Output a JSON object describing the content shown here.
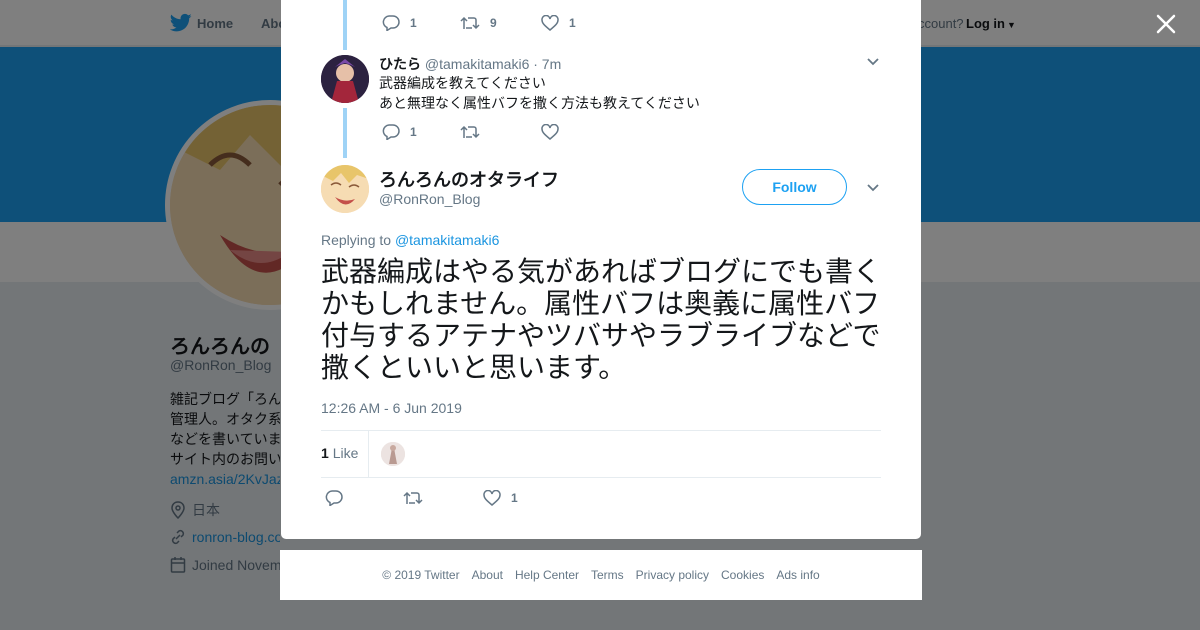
{
  "colors": {
    "accent": "#1da1f2",
    "thread_line": "#9fd3f6",
    "text_secondary": "#657786",
    "overlay": "rgba(0,0,0,0.5)"
  },
  "background": {
    "nav": {
      "home": "Home",
      "about": "Abo",
      "account_prompt": "ccount?",
      "login": "Log in"
    },
    "profile": {
      "name": "ろんろんの",
      "handle": "@RonRon_Blog",
      "bio_lines": [
        "雑記ブログ「ろん",
        "管理人。オタク系",
        "などを書いていま",
        "サイト内のお問い"
      ],
      "bio_link": "amzn.asia/2KvJaz",
      "location": "日本",
      "website": "ronron-blog.com",
      "joined": "Joined Novem"
    }
  },
  "thread": {
    "top_actions": {
      "replies": "1",
      "retweets": "9",
      "likes": "1"
    },
    "reply": {
      "name": "ひたら",
      "handle": "@tamakitamaki6",
      "time": "· 7m",
      "lines": [
        "武器編成を教えてください",
        "あと無理なく属性バフを撒く方法も教えてください"
      ],
      "actions": {
        "replies": "1",
        "retweets": "",
        "likes": ""
      }
    },
    "main": {
      "name": "ろんろんのオタライフ",
      "handle": "@RonRon_Blog",
      "follow_label": "Follow",
      "replying_prefix": "Replying to",
      "replying_to": "@tamakitamaki6",
      "text": "武器編成はやる気があればブログにでも書くかもしれません。属性バフは奥義に属性バフ付与するアテナやツバサやラブライブなどで撒くといいと思います。",
      "timestamp": "12:26 AM - 6 Jun 2019",
      "like_count": "1",
      "like_label": "Like",
      "actions": {
        "replies": "",
        "retweets": "",
        "likes": "1"
      }
    }
  },
  "footer": {
    "copyright": "© 2019 Twitter",
    "links": [
      "About",
      "Help Center",
      "Terms",
      "Privacy policy",
      "Cookies",
      "Ads info"
    ]
  },
  "icons": [
    "twitter-bird-icon",
    "close-icon",
    "reply-icon",
    "retweet-icon",
    "heart-icon",
    "chevron-down-icon",
    "location-icon",
    "link-icon",
    "calendar-icon"
  ]
}
